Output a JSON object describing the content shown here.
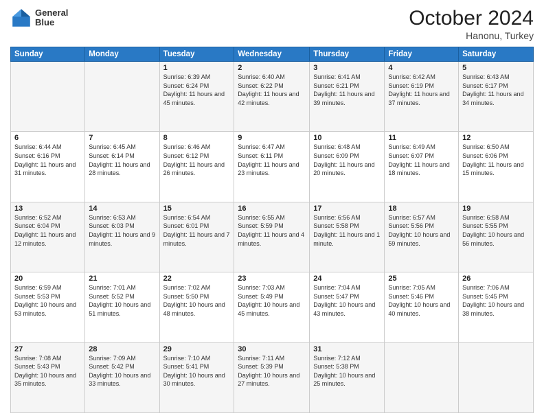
{
  "header": {
    "logo_line1": "General",
    "logo_line2": "Blue",
    "month": "October 2024",
    "location": "Hanonu, Turkey"
  },
  "weekdays": [
    "Sunday",
    "Monday",
    "Tuesday",
    "Wednesday",
    "Thursday",
    "Friday",
    "Saturday"
  ],
  "weeks": [
    [
      {
        "day": "",
        "info": ""
      },
      {
        "day": "",
        "info": ""
      },
      {
        "day": "1",
        "info": "Sunrise: 6:39 AM\nSunset: 6:24 PM\nDaylight: 11 hours and 45 minutes."
      },
      {
        "day": "2",
        "info": "Sunrise: 6:40 AM\nSunset: 6:22 PM\nDaylight: 11 hours and 42 minutes."
      },
      {
        "day": "3",
        "info": "Sunrise: 6:41 AM\nSunset: 6:21 PM\nDaylight: 11 hours and 39 minutes."
      },
      {
        "day": "4",
        "info": "Sunrise: 6:42 AM\nSunset: 6:19 PM\nDaylight: 11 hours and 37 minutes."
      },
      {
        "day": "5",
        "info": "Sunrise: 6:43 AM\nSunset: 6:17 PM\nDaylight: 11 hours and 34 minutes."
      }
    ],
    [
      {
        "day": "6",
        "info": "Sunrise: 6:44 AM\nSunset: 6:16 PM\nDaylight: 11 hours and 31 minutes."
      },
      {
        "day": "7",
        "info": "Sunrise: 6:45 AM\nSunset: 6:14 PM\nDaylight: 11 hours and 28 minutes."
      },
      {
        "day": "8",
        "info": "Sunrise: 6:46 AM\nSunset: 6:12 PM\nDaylight: 11 hours and 26 minutes."
      },
      {
        "day": "9",
        "info": "Sunrise: 6:47 AM\nSunset: 6:11 PM\nDaylight: 11 hours and 23 minutes."
      },
      {
        "day": "10",
        "info": "Sunrise: 6:48 AM\nSunset: 6:09 PM\nDaylight: 11 hours and 20 minutes."
      },
      {
        "day": "11",
        "info": "Sunrise: 6:49 AM\nSunset: 6:07 PM\nDaylight: 11 hours and 18 minutes."
      },
      {
        "day": "12",
        "info": "Sunrise: 6:50 AM\nSunset: 6:06 PM\nDaylight: 11 hours and 15 minutes."
      }
    ],
    [
      {
        "day": "13",
        "info": "Sunrise: 6:52 AM\nSunset: 6:04 PM\nDaylight: 11 hours and 12 minutes."
      },
      {
        "day": "14",
        "info": "Sunrise: 6:53 AM\nSunset: 6:03 PM\nDaylight: 11 hours and 9 minutes."
      },
      {
        "day": "15",
        "info": "Sunrise: 6:54 AM\nSunset: 6:01 PM\nDaylight: 11 hours and 7 minutes."
      },
      {
        "day": "16",
        "info": "Sunrise: 6:55 AM\nSunset: 5:59 PM\nDaylight: 11 hours and 4 minutes."
      },
      {
        "day": "17",
        "info": "Sunrise: 6:56 AM\nSunset: 5:58 PM\nDaylight: 11 hours and 1 minute."
      },
      {
        "day": "18",
        "info": "Sunrise: 6:57 AM\nSunset: 5:56 PM\nDaylight: 10 hours and 59 minutes."
      },
      {
        "day": "19",
        "info": "Sunrise: 6:58 AM\nSunset: 5:55 PM\nDaylight: 10 hours and 56 minutes."
      }
    ],
    [
      {
        "day": "20",
        "info": "Sunrise: 6:59 AM\nSunset: 5:53 PM\nDaylight: 10 hours and 53 minutes."
      },
      {
        "day": "21",
        "info": "Sunrise: 7:01 AM\nSunset: 5:52 PM\nDaylight: 10 hours and 51 minutes."
      },
      {
        "day": "22",
        "info": "Sunrise: 7:02 AM\nSunset: 5:50 PM\nDaylight: 10 hours and 48 minutes."
      },
      {
        "day": "23",
        "info": "Sunrise: 7:03 AM\nSunset: 5:49 PM\nDaylight: 10 hours and 45 minutes."
      },
      {
        "day": "24",
        "info": "Sunrise: 7:04 AM\nSunset: 5:47 PM\nDaylight: 10 hours and 43 minutes."
      },
      {
        "day": "25",
        "info": "Sunrise: 7:05 AM\nSunset: 5:46 PM\nDaylight: 10 hours and 40 minutes."
      },
      {
        "day": "26",
        "info": "Sunrise: 7:06 AM\nSunset: 5:45 PM\nDaylight: 10 hours and 38 minutes."
      }
    ],
    [
      {
        "day": "27",
        "info": "Sunrise: 7:08 AM\nSunset: 5:43 PM\nDaylight: 10 hours and 35 minutes."
      },
      {
        "day": "28",
        "info": "Sunrise: 7:09 AM\nSunset: 5:42 PM\nDaylight: 10 hours and 33 minutes."
      },
      {
        "day": "29",
        "info": "Sunrise: 7:10 AM\nSunset: 5:41 PM\nDaylight: 10 hours and 30 minutes."
      },
      {
        "day": "30",
        "info": "Sunrise: 7:11 AM\nSunset: 5:39 PM\nDaylight: 10 hours and 27 minutes."
      },
      {
        "day": "31",
        "info": "Sunrise: 7:12 AM\nSunset: 5:38 PM\nDaylight: 10 hours and 25 minutes."
      },
      {
        "day": "",
        "info": ""
      },
      {
        "day": "",
        "info": ""
      }
    ]
  ]
}
